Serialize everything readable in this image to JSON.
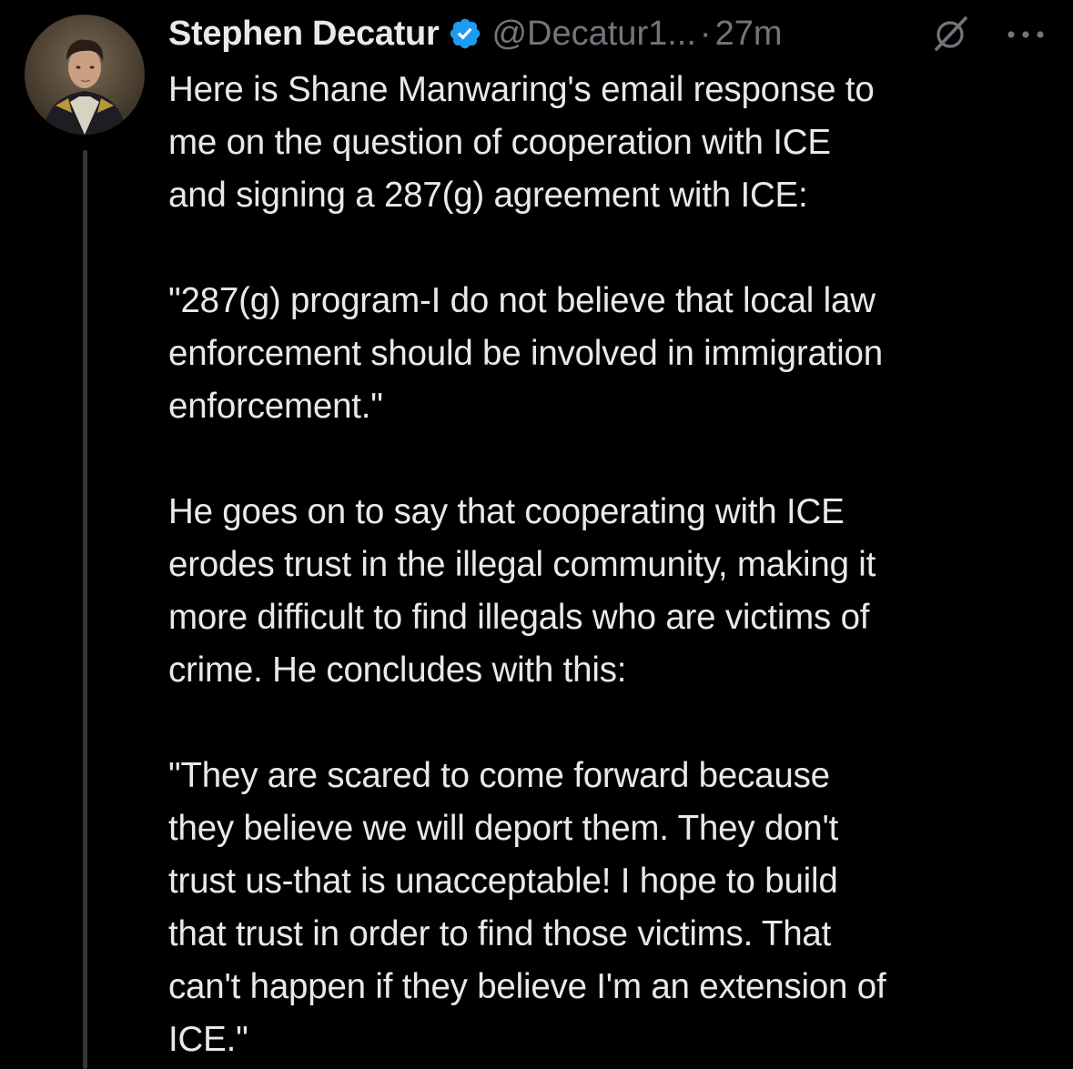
{
  "tweet": {
    "author": {
      "display_name": "Stephen Decatur",
      "handle": "@Decatur1...",
      "verified": true,
      "avatar_icon": "portrait-avatar"
    },
    "separator": "·",
    "timestamp": "27m",
    "icons": {
      "verified": "verified-badge-icon",
      "grok": "grok-icon",
      "more": "more-options-icon"
    },
    "colors": {
      "background": "#000000",
      "text": "#e7e9ea",
      "secondary_text": "#71767b",
      "verified_blue": "#1d9bf0",
      "thread_line": "#333639"
    },
    "body": {
      "p1_lines": [
        "Here is Shane Manwaring's email response to",
        "me on the question of cooperation with ICE",
        "and signing a 287(g) agreement with ICE:"
      ],
      "p2_lines": [
        "\"287(g) program-I do not believe that local law",
        "enforcement should be involved in immigration",
        "enforcement.\""
      ],
      "p3_lines": [
        "He goes on to say that cooperating with ICE",
        "erodes trust in the illegal community, making it",
        "more difficult to find illegals who are victims of",
        "crime.  He concludes with this:"
      ],
      "p4_lines": [
        "\"They are scared to come forward because",
        "they believe we will deport them.  They don't",
        "trust us-that is unacceptable!  I hope to build",
        "that trust in order to find those victims.  That",
        "can't happen if they believe I'm an extension of",
        "ICE.\""
      ]
    }
  }
}
